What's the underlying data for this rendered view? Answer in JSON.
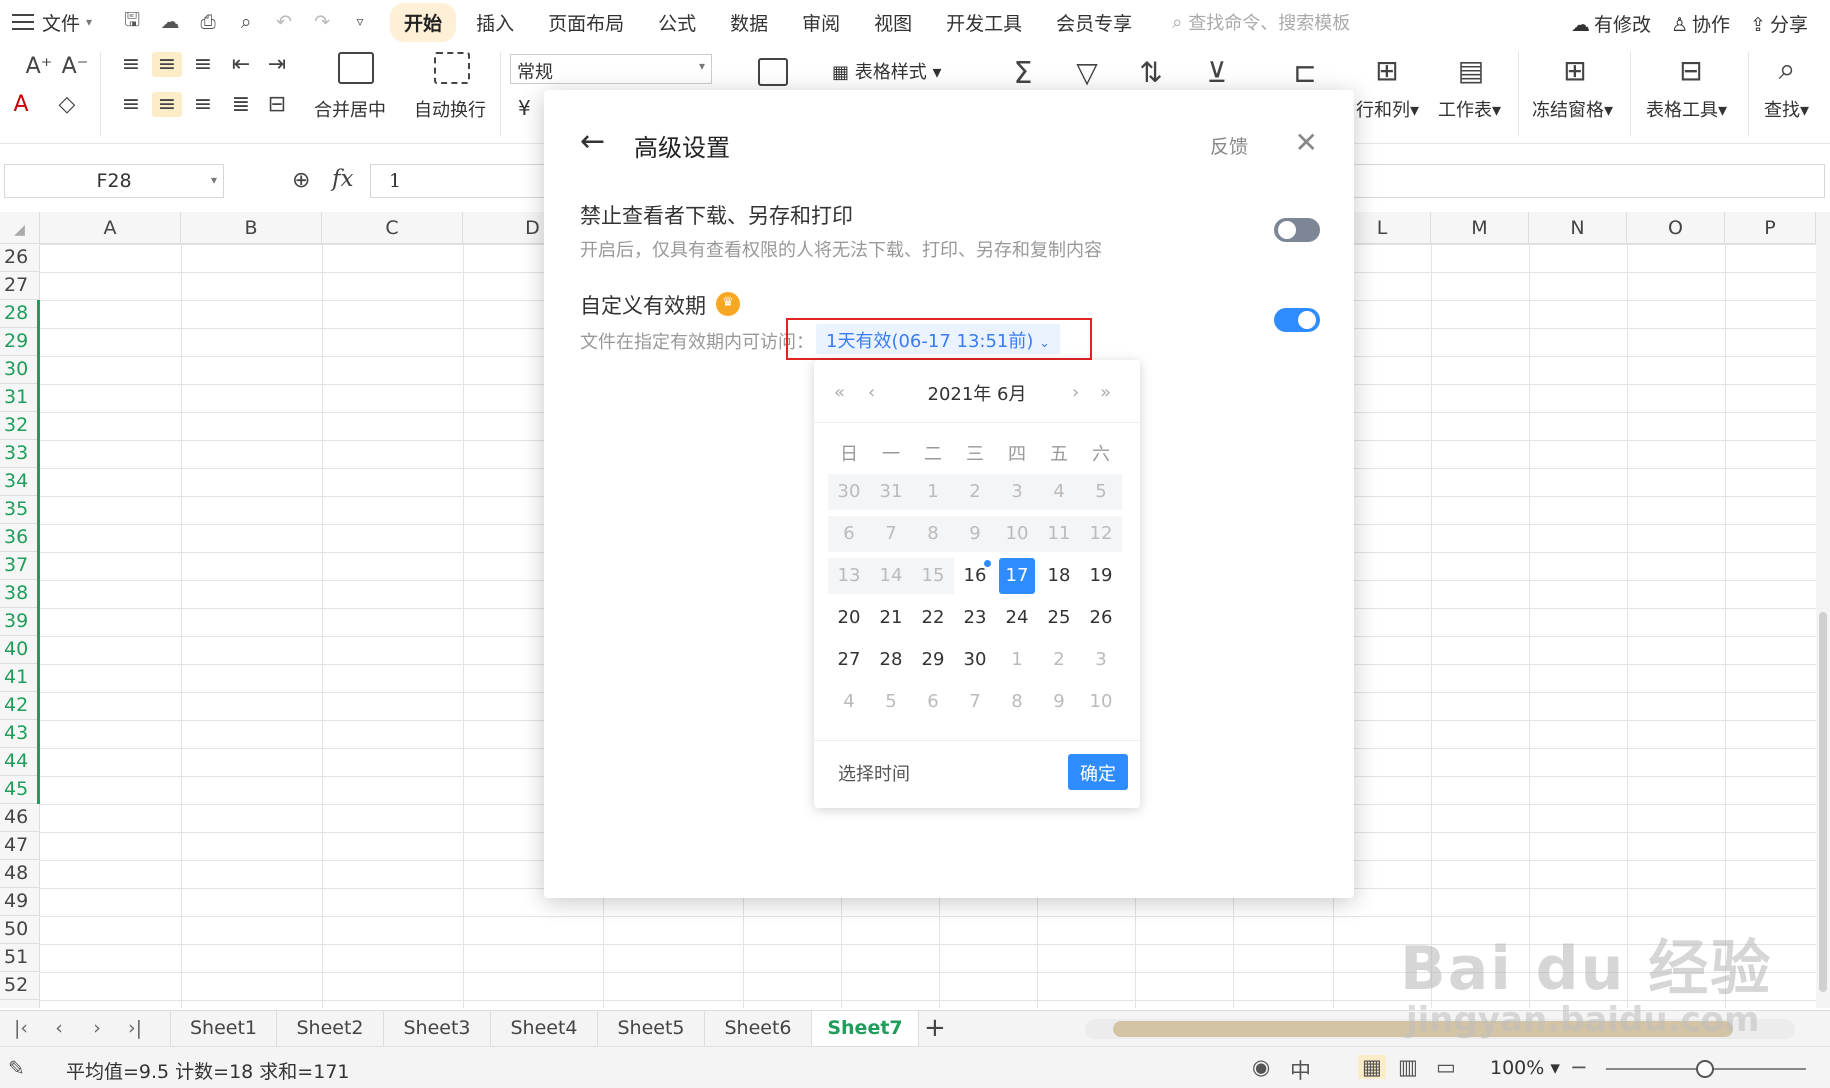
{
  "menubar": {
    "file_label": "文件",
    "tabs": [
      "开始",
      "插入",
      "页面布局",
      "公式",
      "数据",
      "审阅",
      "视图",
      "开发工具",
      "会员专享"
    ],
    "search_placeholder": "查找命令、搜索模板",
    "right": [
      "有修改",
      "协作",
      "分享"
    ]
  },
  "ribbon": {
    "number_format": "常规",
    "merge_label": "合并居中",
    "wrap_label": "自动换行",
    "table_style_label": "表格样式",
    "rowcol_label": "行和列",
    "sheet_label": "工作表",
    "freeze_label": "冻结窗格",
    "tools_label": "表格工具",
    "find_label": "查找",
    "currency_symbol": "¥"
  },
  "formula_bar": {
    "name_box": "F28",
    "fx": "fx",
    "value": "1"
  },
  "grid": {
    "columns": [
      "A",
      "B",
      "C",
      "D",
      "L",
      "M",
      "N",
      "O",
      "P"
    ],
    "rows": [
      "26",
      "27",
      "28",
      "29",
      "30",
      "31",
      "32",
      "33",
      "34",
      "35",
      "36",
      "37",
      "38",
      "39",
      "40",
      "41",
      "42",
      "43",
      "44",
      "45",
      "46",
      "47",
      "48",
      "49",
      "50",
      "51",
      "52"
    ]
  },
  "sheets": {
    "tabs": [
      "Sheet1",
      "Sheet2",
      "Sheet3",
      "Sheet4",
      "Sheet5",
      "Sheet6",
      "Sheet7"
    ],
    "active": "Sheet7",
    "add": "+"
  },
  "status": {
    "summary": "平均值=9.5  计数=18  求和=171",
    "zoom": "100%"
  },
  "dialog": {
    "title": "高级设置",
    "feedback": "反馈",
    "option1": {
      "title": "禁止查看者下载、另存和打印",
      "desc": "开启后，仅具有查看权限的人将无法下载、打印、另存和复制内容",
      "enabled": false
    },
    "option2": {
      "title": "自定义有效期",
      "desc": "文件在指定有效期内可访问：",
      "selected": "1天有效(06-17 13:51前)",
      "enabled": true
    },
    "colors": {
      "accent": "#2f8cff",
      "highlight_box": "#e02424",
      "badge": "#f5a623"
    }
  },
  "calendar": {
    "title": "2021年 6月",
    "weekdays": [
      "日",
      "一",
      "二",
      "三",
      "四",
      "五",
      "六"
    ],
    "weeks": [
      [
        "30",
        "31",
        "1",
        "2",
        "3",
        "4",
        "5"
      ],
      [
        "6",
        "7",
        "8",
        "9",
        "10",
        "11",
        "12"
      ],
      [
        "13",
        "14",
        "15",
        "16",
        "17",
        "18",
        "19"
      ],
      [
        "20",
        "21",
        "22",
        "23",
        "24",
        "25",
        "26"
      ],
      [
        "27",
        "28",
        "29",
        "30",
        "1",
        "2",
        "3"
      ],
      [
        "4",
        "5",
        "6",
        "7",
        "8",
        "9",
        "10"
      ]
    ],
    "today": "16",
    "selected": "17",
    "select_time": "选择时间",
    "confirm": "确定"
  },
  "watermark": {
    "line1": "Bai du 经验",
    "line2": "jingyan.baidu.com"
  }
}
